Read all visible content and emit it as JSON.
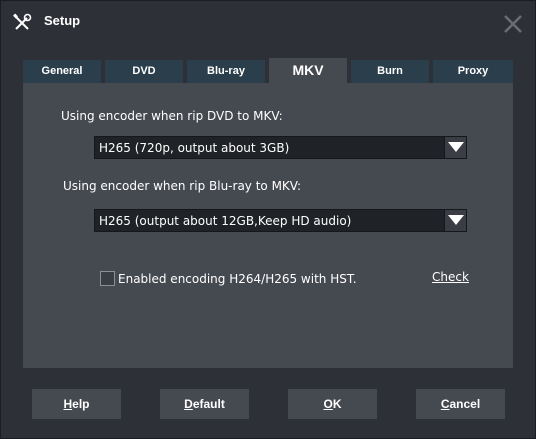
{
  "window": {
    "title": "Setup"
  },
  "tabs": [
    {
      "label": "General",
      "active": false
    },
    {
      "label": "DVD",
      "active": false
    },
    {
      "label": "Blu-ray",
      "active": false
    },
    {
      "label": "MKV",
      "active": true
    },
    {
      "label": "Burn",
      "active": false
    },
    {
      "label": "Proxy",
      "active": false
    }
  ],
  "mkv": {
    "dvd_encoder": {
      "label": "Using encoder when rip DVD to MKV:",
      "value": "H265 (720p, output about 3GB)"
    },
    "bluray_encoder": {
      "label": "Using encoder when rip Blu-ray to MKV:",
      "value": "H265 (output about 12GB,Keep HD audio)"
    },
    "hst": {
      "label": "Enabled encoding H264/H265 with HST.",
      "checked": false
    },
    "check_link": "Check"
  },
  "buttons": {
    "help": {
      "first": "H",
      "rest": "elp"
    },
    "default": {
      "first": "D",
      "rest": "efault"
    },
    "ok": {
      "first": "O",
      "rest": "K"
    },
    "cancel": {
      "first": "C",
      "rest": "ancel"
    }
  },
  "icons": {
    "app": "tools-icon",
    "close": "close-icon",
    "dropdown": "triangle-down-icon"
  },
  "colors": {
    "window_bg": "#2d3137",
    "panel_bg": "#454950",
    "tab_inactive_bg": "#2b3e4b",
    "select_bg": "#1f2226"
  }
}
